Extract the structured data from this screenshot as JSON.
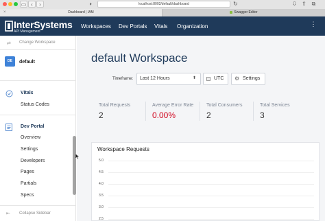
{
  "browser": {
    "url": "localhost:8002/default/dashboard",
    "tabs": [
      {
        "label": "Dashboard | IAM"
      },
      {
        "label": "Swagger Editor"
      }
    ],
    "traffic_colors": [
      "#fe5f57",
      "#febc2e",
      "#28c840"
    ]
  },
  "app": {
    "logo_name": "InterSystems",
    "logo_sub": "API Management",
    "nav": [
      "Workspaces",
      "Dev Portals",
      "Vitals",
      "Organization"
    ],
    "menu_icon": "kebab-icon",
    "brand_color": "#1f3a5a"
  },
  "sidebar": {
    "change_workspace": "Change Workspace",
    "workspace_badge": "DE",
    "workspace_name": "default",
    "vitals": {
      "title": "Vitals",
      "items": [
        "Status Codes"
      ]
    },
    "dev_portal": {
      "title": "Dev Portal",
      "items": [
        "Overview",
        "Settings",
        "Developers",
        "Pages",
        "Partials",
        "Specs"
      ]
    },
    "collapse": "Collapse Sidebar"
  },
  "main": {
    "title": "default Workspace",
    "timeframe_label": "Timeframe:",
    "timeframe_value": "Last 12 Hours",
    "utc_label": "UTC",
    "settings_label": "Settings",
    "stats": [
      {
        "label": "Total Requests",
        "value": "2"
      },
      {
        "label": "Average Error Rate",
        "value": "0.00%",
        "color": "#d0021b"
      },
      {
        "label": "Total Consumers",
        "value": "2"
      },
      {
        "label": "Total Services",
        "value": "3"
      }
    ],
    "chart_card": {
      "title": "Workspace Requests"
    }
  },
  "chart_data": {
    "type": "line",
    "title": "",
    "xlabel": "",
    "ylabel": "",
    "y_ticks": [
      "5.0",
      "4.5",
      "4.0",
      "3.5",
      "3.0",
      "2.5"
    ],
    "ylim": [
      2.5,
      5.0
    ],
    "grid": true
  }
}
